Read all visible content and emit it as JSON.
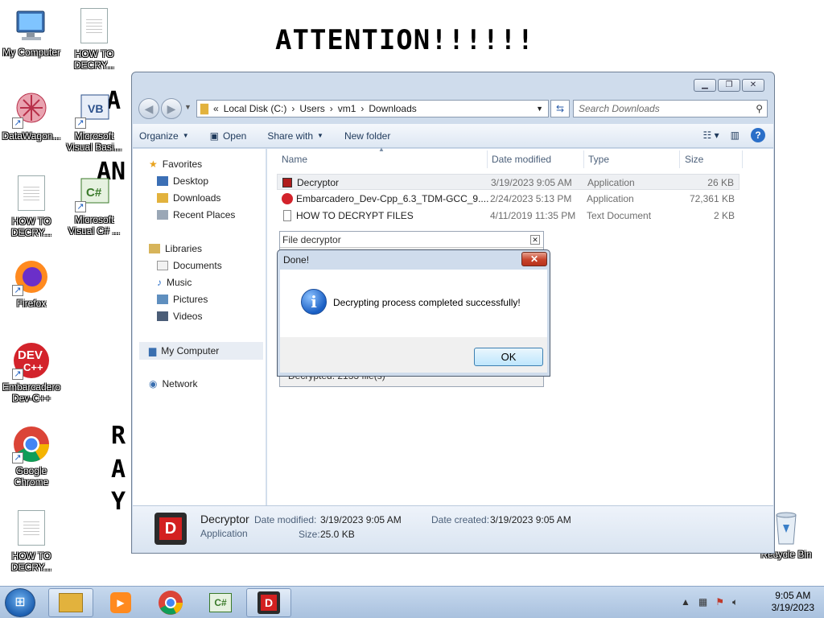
{
  "desktop": {
    "attention_text": "ATTENTION!!!!!!",
    "icons": [
      {
        "label": "My Computer"
      },
      {
        "label": "HOW TO DECRY..."
      },
      {
        "label": "DataWagon..."
      },
      {
        "label": "Microsoft Visual Basi..."
      },
      {
        "label": "HOW TO DECRY..."
      },
      {
        "label": "Microsoft Visual C# ..."
      },
      {
        "label": "Firefox"
      },
      {
        "label": "Embarcadero Dev-C++"
      },
      {
        "label": "Google Chrome"
      },
      {
        "label": "HOW TO DECRY..."
      },
      {
        "label": "Recycle Bin"
      }
    ],
    "partial_text": [
      "A",
      "AN",
      "R",
      "A",
      "Y"
    ]
  },
  "explorer": {
    "address": {
      "prefix": "«",
      "parts": [
        "Local Disk (C:)",
        "Users",
        "vm1",
        "Downloads"
      ]
    },
    "search_placeholder": "Search Downloads",
    "toolbar": {
      "organize": "Organize",
      "open": "Open",
      "share_with": "Share with",
      "new_folder": "New folder"
    },
    "nav": {
      "favorites": "Favorites",
      "desktop": "Desktop",
      "downloads": "Downloads",
      "recent_places": "Recent Places",
      "libraries": "Libraries",
      "documents": "Documents",
      "music": "Music",
      "pictures": "Pictures",
      "videos": "Videos",
      "my_computer": "My Computer",
      "network": "Network"
    },
    "columns": {
      "name": "Name",
      "date": "Date modified",
      "type": "Type",
      "size": "Size"
    },
    "files": [
      {
        "name": "Decryptor",
        "date": "3/19/2023 9:05 AM",
        "type": "Application",
        "size": "26 KB"
      },
      {
        "name": "Embarcadero_Dev-Cpp_6.3_TDM-GCC_9....",
        "date": "2/24/2023 5:13 PM",
        "type": "Application",
        "size": "72,361 KB"
      },
      {
        "name": "HOW TO DECRYPT FILES",
        "date": "4/11/2019 11:35 PM",
        "type": "Text Document",
        "size": "2 KB"
      }
    ],
    "details": {
      "name": "Decryptor",
      "type": "Application",
      "modified_label": "Date modified:",
      "modified": "3/19/2023 9:05 AM",
      "created_label": "Date created:",
      "created": "3/19/2023 9:05 AM",
      "size_label": "Size:",
      "size": "25.0 KB"
    }
  },
  "decryptor_window": {
    "title": "File decryptor",
    "status": "Decrypted: 2133 file(s)"
  },
  "message_box": {
    "title": "Done!",
    "message": "Decrypting process completed successfully!",
    "ok": "OK"
  },
  "taskbar": {
    "time": "9:05 AM",
    "date": "3/19/2023"
  }
}
